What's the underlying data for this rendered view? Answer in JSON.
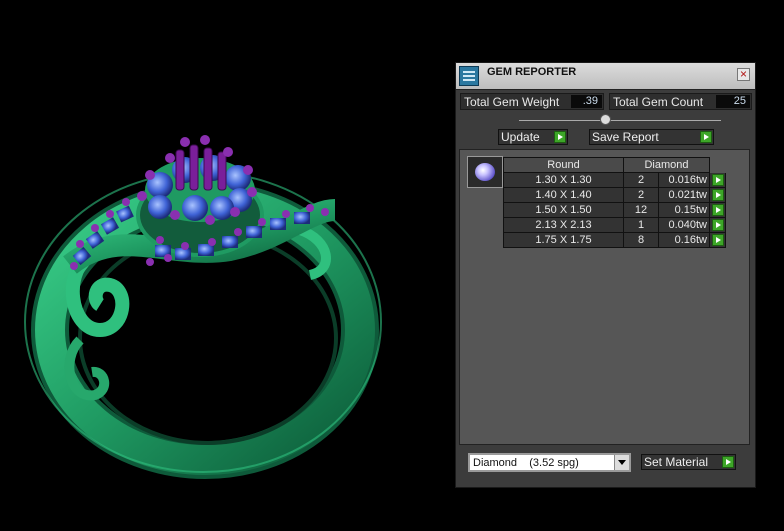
{
  "panel": {
    "title": "GEM REPORTER",
    "close_glyph": "×",
    "total_weight_label": "Total Gem Weight",
    "total_weight_value": ".39",
    "total_count_label": "Total Gem Count",
    "total_count_value": "25",
    "update_label": "Update",
    "save_report_label": "Save Report",
    "table": {
      "headers": [
        "Round",
        "Diamond"
      ],
      "rows": [
        {
          "size": "1.30 X 1.30",
          "count": "2",
          "weight": "0.016tw"
        },
        {
          "size": "1.40 X 1.40",
          "count": "2",
          "weight": "0.021tw"
        },
        {
          "size": "1.50 X 1.50",
          "count": "12",
          "weight": "0.15tw"
        },
        {
          "size": "2.13 X 2.13",
          "count": "1",
          "weight": "0.040tw"
        },
        {
          "size": "1.75 X 1.75",
          "count": "8",
          "weight": "0.16tw"
        }
      ]
    },
    "material_value": "Diamond    (3.52 spg)",
    "set_material_label": "Set Material"
  },
  "colors": {
    "metal": "#1e8a5a",
    "stone": "#3a5fc8",
    "prong": "#7a1f9a",
    "button_green": "#3da628"
  },
  "icons": [
    "gem-reporter-logo-icon",
    "close-icon",
    "play-arrow-icon",
    "round-gem-icon",
    "dropdown-arrow-icon"
  ]
}
